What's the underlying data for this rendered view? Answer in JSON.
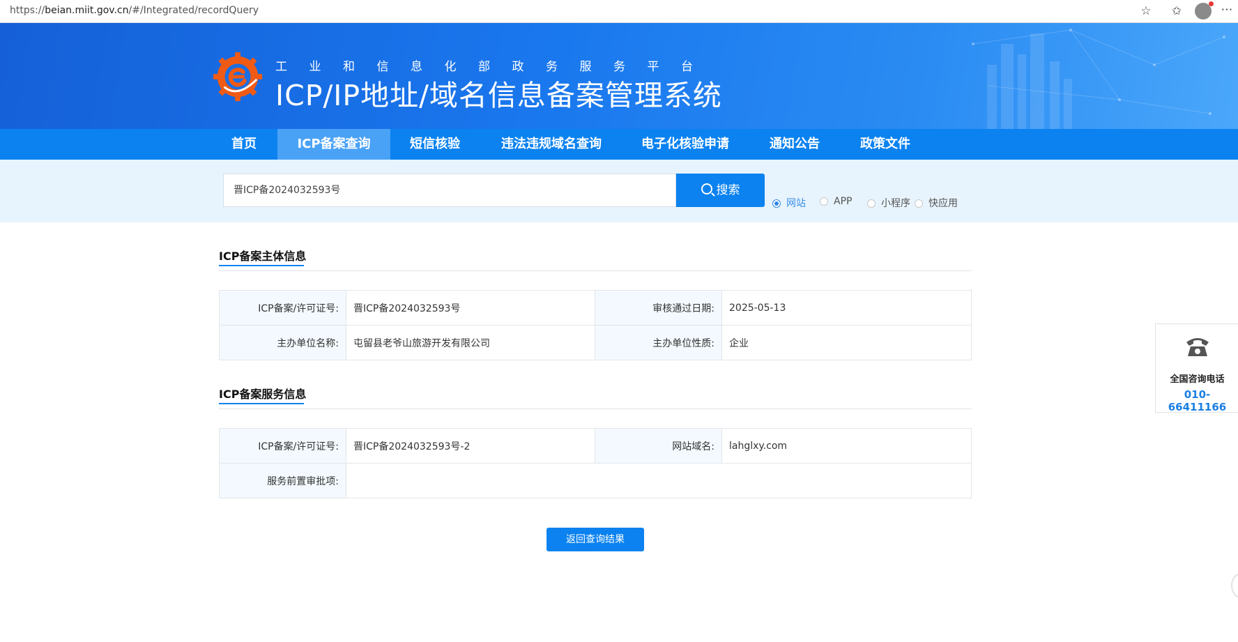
{
  "browser": {
    "url_prefix": "https://",
    "url_host": "beian.miit.gov.cn",
    "url_path": "/#/Integrated/recordQuery"
  },
  "header": {
    "subtitle": "工业和信息化部政务服务平台",
    "title": "ICP/IP地址/域名信息备案管理系统"
  },
  "nav": {
    "items": [
      {
        "label": "首页"
      },
      {
        "label": "ICP备案查询"
      },
      {
        "label": "短信核验"
      },
      {
        "label": "违法违规域名查询"
      },
      {
        "label": "电子化核验申请"
      },
      {
        "label": "通知公告"
      },
      {
        "label": "政策文件"
      }
    ],
    "active": "ICP备案查询"
  },
  "search": {
    "value": "晋ICP备2024032593号",
    "button_label": "搜索",
    "options": [
      "网站",
      "APP",
      "小程序",
      "快应用"
    ],
    "selected": "网站"
  },
  "subject_info": {
    "title": "ICP备案主体信息",
    "rows": [
      [
        {
          "label": "ICP备案/许可证号:",
          "value": "晋ICP备2024032593号"
        },
        {
          "label": "审核通过日期:",
          "value": "2025-05-13"
        }
      ],
      [
        {
          "label": "主办单位名称:",
          "value": "屯留县老爷山旅游开发有限公司"
        },
        {
          "label": "主办单位性质:",
          "value": "企业"
        }
      ]
    ]
  },
  "service_info": {
    "title": "ICP备案服务信息",
    "rows": [
      [
        {
          "label": "ICP备案/许可证号:",
          "value": "晋ICP备2024032593号-2"
        },
        {
          "label": "网站域名:",
          "value": "lahglxy.com"
        }
      ],
      [
        {
          "label": "服务前置审批项:",
          "value": ""
        }
      ]
    ]
  },
  "back_button": "返回查询结果",
  "hotline": {
    "label": "全国咨询电话",
    "number": "010-66411166"
  },
  "colors": {
    "primary": "#0b82f0",
    "nav_active": "#4aa2f7",
    "search_band": "#e8f4fd",
    "label_cell": "#f3f9fe",
    "logo_orange": "#f05a14"
  }
}
